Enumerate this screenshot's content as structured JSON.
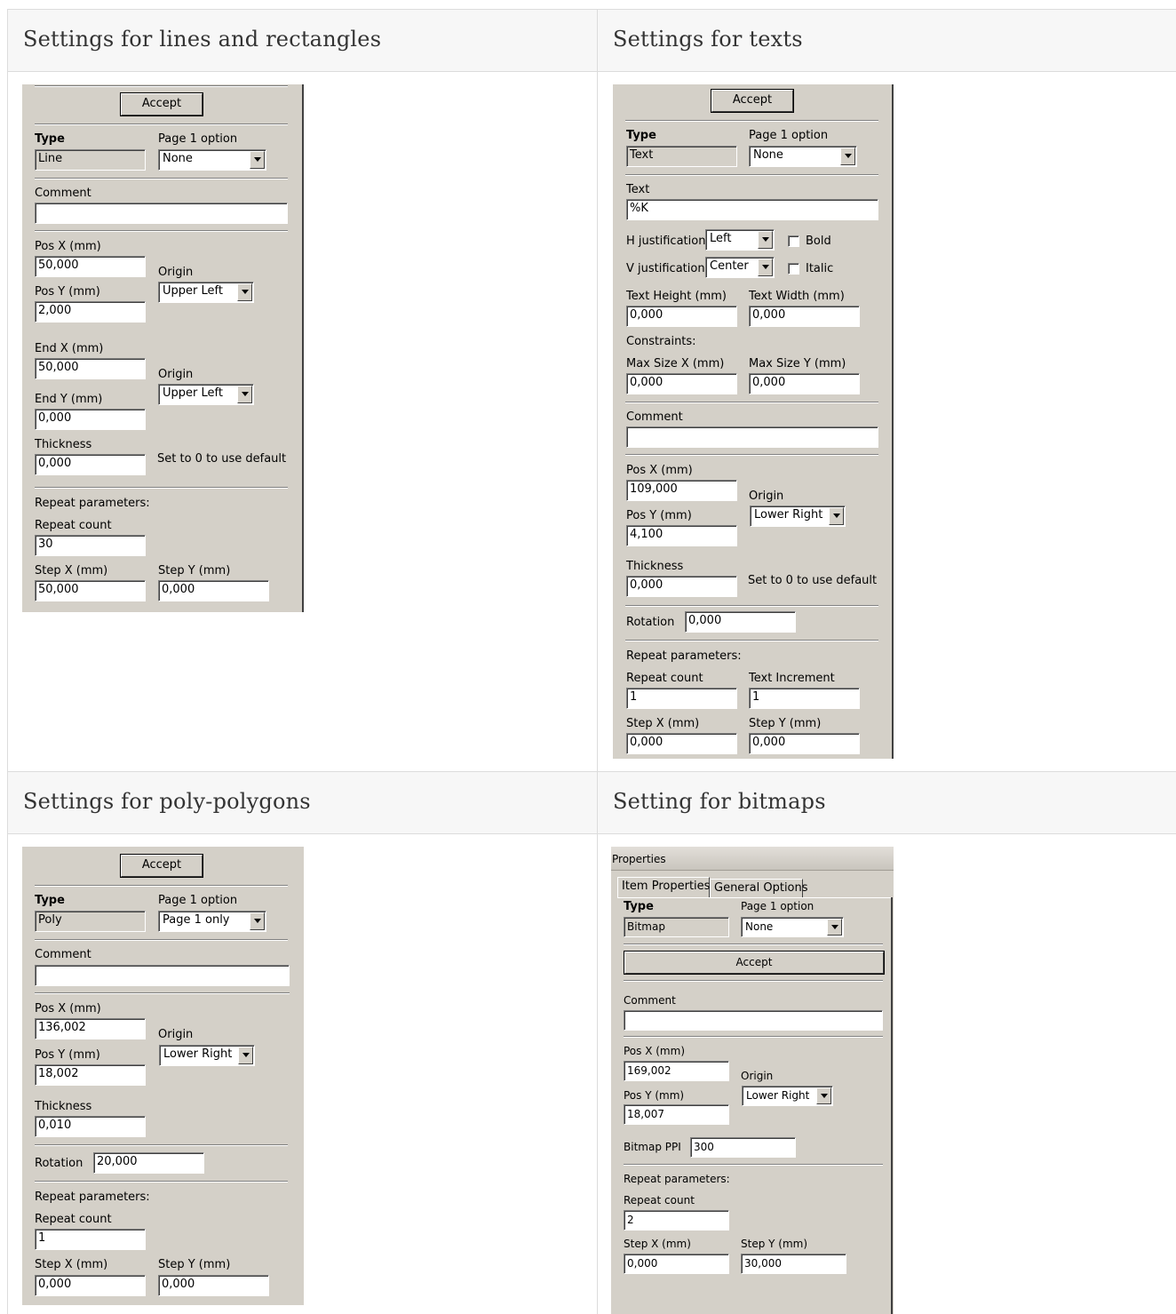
{
  "headers": {
    "lines": "Settings for lines and rectangles",
    "texts": "Settings for texts",
    "poly": "Settings for poly-polygons",
    "bitmaps": "Setting for bitmaps"
  },
  "common": {
    "accept": "Accept",
    "type_label": "Type",
    "page1_label": "Page 1 option",
    "comment_label": "Comment",
    "posx_label": "Pos X (mm)",
    "posy_label": "Pos Y (mm)",
    "origin_label": "Origin",
    "thickness_label": "Thickness",
    "set0_label": "Set to 0 to use default",
    "rotation_label": "Rotation",
    "repeat_params_label": "Repeat parameters:",
    "repeat_count_label": "Repeat count",
    "stepx_label": "Step X (mm)",
    "stepy_label": "Step Y (mm)"
  },
  "lines": {
    "type": "Line",
    "page1": "None",
    "comment": "",
    "posx": "50,000",
    "posy": "2,000",
    "origin1": "Upper Left",
    "endx_label": "End X (mm)",
    "endy_label": "End Y (mm)",
    "endx": "50,000",
    "endy": "0,000",
    "origin2": "Upper Left",
    "thickness": "0,000",
    "repeat_count": "30",
    "stepx": "50,000",
    "stepy": "0,000"
  },
  "texts": {
    "type": "Text",
    "page1": "None",
    "text_label": "Text",
    "text": "%K",
    "hjust_label": "H justification",
    "hjust": "Left",
    "vjust_label": "V justification",
    "vjust": "Center",
    "bold_label": "Bold",
    "italic_label": "Italic",
    "theight_label": "Text Height (mm)",
    "twidth_label": "Text Width (mm)",
    "theight": "0,000",
    "twidth": "0,000",
    "constraints_label": "Constraints:",
    "maxx_label": "Max Size X (mm)",
    "maxy_label": "Max Size Y (mm)",
    "maxx": "0,000",
    "maxy": "0,000",
    "comment": "",
    "posx": "109,000",
    "posy": "4,100",
    "origin": "Lower Right",
    "thickness": "0,000",
    "rotation": "0,000",
    "repeat_count": "1",
    "text_inc_label": "Text Increment",
    "text_inc": "1",
    "stepx": "0,000",
    "stepy": "0,000"
  },
  "poly": {
    "type": "Poly",
    "page1": "Page 1 only",
    "comment": "",
    "posx": "136,002",
    "posy": "18,002",
    "origin": "Lower Right",
    "thickness": "0,010",
    "rotation": "20,000",
    "repeat_count": "1",
    "stepx": "0,000",
    "stepy": "0,000"
  },
  "bitmaps": {
    "window_title": "Properties",
    "tab1": "Item Properties",
    "tab2": "General Options",
    "type": "Bitmap",
    "page1": "None",
    "comment": "",
    "posx": "169,002",
    "posy": "18,007",
    "origin": "Lower Right",
    "ppi_label": "Bitmap PPI",
    "ppi": "300",
    "repeat_count": "2",
    "stepx": "0,000",
    "stepy": "30,000"
  }
}
